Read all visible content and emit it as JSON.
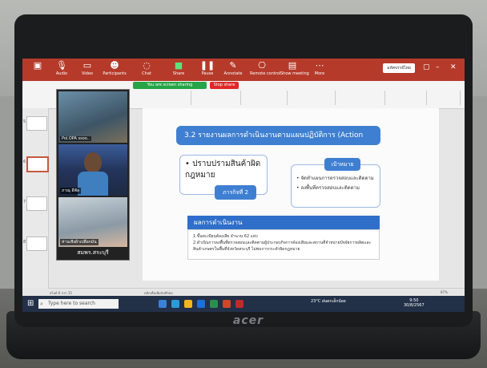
{
  "zoom_toolbar": {
    "presenter_name": "มหัศจรรย์ไทย",
    "items": [
      {
        "icon": "microphone-icon",
        "label": "Audio"
      },
      {
        "icon": "video-icon",
        "label": "Video"
      },
      {
        "icon": "participants-icon",
        "label": "Participants"
      },
      {
        "icon": "chat-icon",
        "label": "Chat"
      },
      {
        "icon": "share-icon",
        "label": "Share"
      },
      {
        "icon": "pause-icon",
        "label": "Pause"
      },
      {
        "icon": "annotate-icon",
        "label": "Annotate"
      },
      {
        "icon": "remote-control-icon",
        "label": "Remote control"
      },
      {
        "icon": "show-meeting-icon",
        "label": "Show meeting"
      },
      {
        "icon": "more-icon",
        "label": "More"
      }
    ],
    "sharing_status": "You are screen sharing",
    "stop_label": "Stop share"
  },
  "gallery": {
    "tiles": [
      {
        "name": "Pol.OPA ssoo.."
      },
      {
        "name": "ภาณุ อีฟัล"
      },
      {
        "name": "ห่านเชิงผ้าเปลือกมัน"
      }
    ],
    "footer_label": "สมพร.สระบุรี"
  },
  "slides": {
    "numbers": [
      "5",
      "6",
      "7",
      "8"
    ]
  },
  "slide": {
    "title": "3.2 รายงานผลการดำเนินงานตามแผนปฏิบัติการ (Action Plan)",
    "bullet": "• ปราบปรามสินค้าผิดกฎหมาย",
    "mission": "ภารกิจที่ 2",
    "target_label": "เป้าหมาย",
    "targets": [
      "• จัดทำแผนการตรวจสอบและติดตาม",
      "• ลงพื้นที่ตรวจสอบและติดตาม"
    ],
    "result_title": "ผลการดำเนินงาน",
    "results": [
      "1.ขึ้นทะเบียนต้องเสีย จำนวน 62 แห่ง",
      "2.ดำเนินการลงพื้นที่ตรวจสอบและติดตามผู้ประกอบกิจการค้องเสียและสถานที่จำหน่ายปัจจัยการผลิตและสินค้าเกษตรในพื้นที่จังหวัดสระบุรี ไม่พบการกระทำผิดกฎหมาย"
    ]
  },
  "status_bar": {
    "slide_info": "สไลด์ 6 จาก 15",
    "notes": "คลิกเพื่อเพิ่มบันทึกย่อ",
    "zoom": "87%"
  },
  "taskbar": {
    "search_placeholder": "Type here to search",
    "weather": "23°C ฝนตกเล็กน้อย",
    "time": "9:50",
    "date": "30/8/2567"
  },
  "laptop_brand": "acer"
}
